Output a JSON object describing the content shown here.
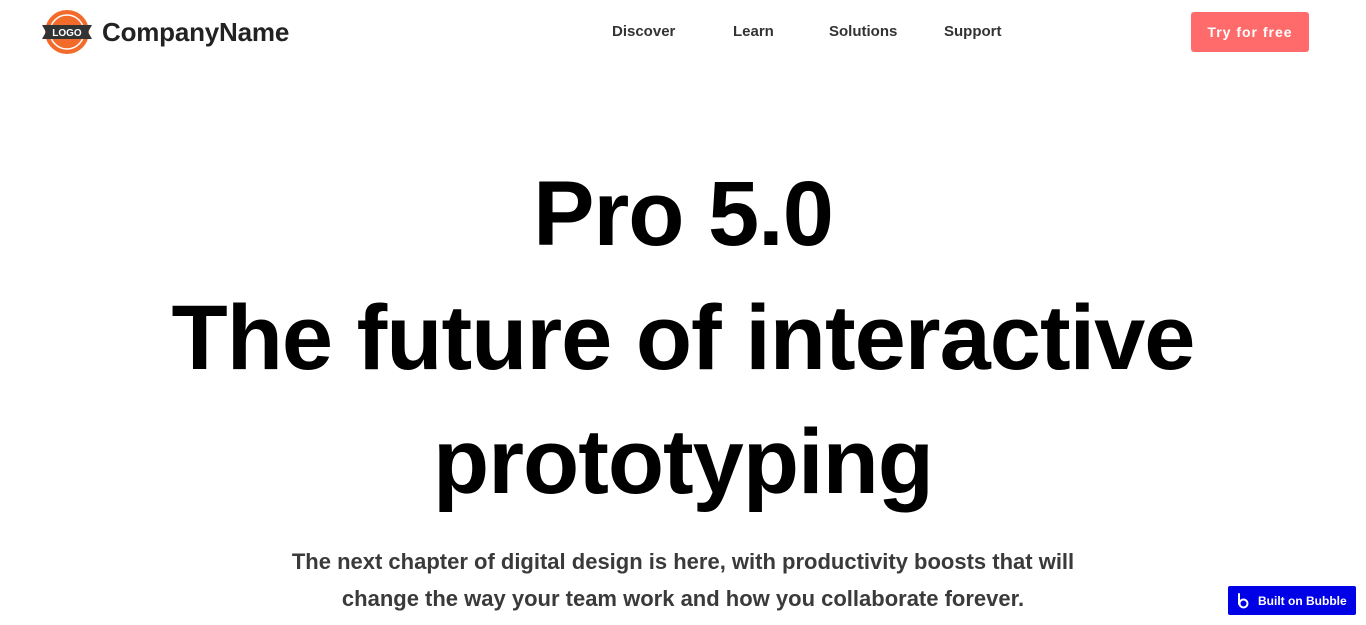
{
  "header": {
    "logo_text": "LOGO",
    "brand_name": "CompanyName",
    "nav": [
      {
        "label": "Discover"
      },
      {
        "label": "Learn"
      },
      {
        "label": "Solutions"
      },
      {
        "label": "Support"
      }
    ],
    "cta_label": "Try for free"
  },
  "hero": {
    "title_lines": [
      "Pro 5.0",
      "The future of interactive",
      "prototyping"
    ],
    "subtitle_lines": [
      "The next chapter of digital design is here, with productivity boosts that will",
      "change the way your team work and how you collaborate forever."
    ]
  },
  "badge": {
    "label": "Built on Bubble",
    "icon": "bubble-icon"
  },
  "colors": {
    "accent": "#ff6b6b",
    "logo_orange": "#f26b2a",
    "badge_blue": "#0000e6"
  }
}
